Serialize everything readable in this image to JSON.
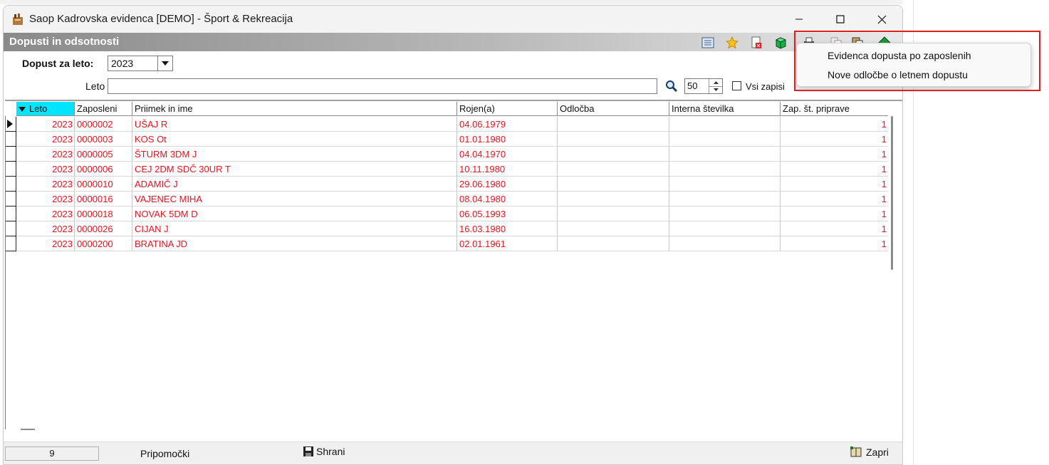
{
  "window": {
    "title": "Saop Kadrovska evidenca [DEMO] - Šport & Rekreacija"
  },
  "panel": {
    "title": "Dopusti in odsotnosti"
  },
  "filters": {
    "year_label": "Dopust za leto:",
    "year_value": "2023",
    "search_label": "Leto",
    "search_value": "",
    "limit_value": "50",
    "all_records_label": "Vsi zapisi"
  },
  "grid": {
    "columns": [
      "Leto",
      "Zaposleni",
      "Priimek in ime",
      "Rojen(a)",
      "Odločba",
      "Interna številka",
      "Zap. št. priprave"
    ],
    "rows": [
      [
        "2023",
        "0000002",
        "UŠAJ R",
        "04.06.1979",
        "",
        "",
        "1"
      ],
      [
        "2023",
        "0000003",
        "KOS Ot",
        "01.01.1980",
        "",
        "",
        "1"
      ],
      [
        "2023",
        "0000005",
        "ŠTURM 3DM J",
        "04.04.1970",
        "",
        "",
        "1"
      ],
      [
        "2023",
        "0000006",
        "CEJ 2DM SDČ 30UR T",
        "10.11.1980",
        "",
        "",
        "1"
      ],
      [
        "2023",
        "0000010",
        "ADAMIČ J",
        "29.06.1980",
        "",
        "",
        "1"
      ],
      [
        "2023",
        "0000016",
        "VAJENEC MIHA",
        "08.04.1980",
        "",
        "",
        "1"
      ],
      [
        "2023",
        "0000018",
        "NOVAK 5DM D",
        "06.05.1993",
        "",
        "",
        "1"
      ],
      [
        "2023",
        "0000026",
        "CIJAN J",
        "16.03.1980",
        "",
        "",
        "1"
      ],
      [
        "2023",
        "0000200",
        "BRATINA JD",
        "02.01.1961",
        "",
        "",
        "1"
      ]
    ]
  },
  "status": {
    "count": "9",
    "tools_label": "Pripomočki",
    "save_label": "Shrani",
    "close_label": "Zapri"
  },
  "menu": {
    "items": [
      "Evidenca dopusta po zaposlenih",
      "Nove odločbe o letnem dopustu"
    ]
  },
  "colors": {
    "row_text": "#e8141c",
    "sort_header": "#00e5ff",
    "highlight": "#e02020"
  }
}
